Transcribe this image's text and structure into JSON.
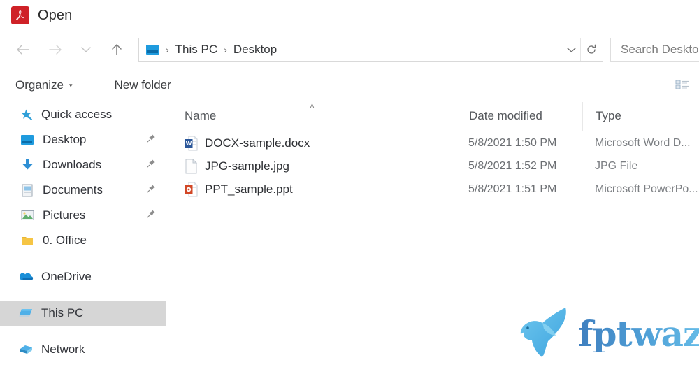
{
  "window": {
    "title": "Open",
    "app_icon": "adobe-acrobat-icon",
    "accent_red": "#cf2127",
    "accent_blue": "#1f9bde",
    "selection_gray": "#d6d6d6"
  },
  "navigation": {
    "back_icon": "arrow-left-icon",
    "forward_icon": "arrow-right-icon",
    "recent_icon": "chevron-down-icon",
    "up_icon": "arrow-up-icon",
    "address": {
      "location_icon": "desktop-monitor-icon",
      "separator": "›",
      "crumbs": [
        "This PC",
        "Desktop"
      ],
      "dropdown_icon": "chevron-down-icon",
      "refresh_icon": "refresh-icon"
    },
    "search": {
      "placeholder": "Search Desktop",
      "value": ""
    }
  },
  "toolbar": {
    "organize_label": "Organize",
    "organize_caret": "▾",
    "new_folder_label": "New folder",
    "view_icon": "list-view-icon"
  },
  "sidebar": {
    "groups": [
      {
        "header": {
          "label": "Quick access",
          "icon": "star-pin-icon"
        },
        "items": [
          {
            "label": "Desktop",
            "icon": "desktop-monitor-icon",
            "pinned": true
          },
          {
            "label": "Downloads",
            "icon": "download-arrow-icon",
            "pinned": true
          },
          {
            "label": "Documents",
            "icon": "documents-icon",
            "pinned": true
          },
          {
            "label": "Pictures",
            "icon": "pictures-icon",
            "pinned": true
          },
          {
            "label": "0. Office",
            "icon": "folder-icon",
            "pinned": false
          }
        ]
      },
      {
        "header": null,
        "items": [
          {
            "label": "OneDrive",
            "icon": "onedrive-cloud-icon",
            "pinned": false
          }
        ]
      },
      {
        "header": null,
        "items": [
          {
            "label": "This PC",
            "icon": "this-pc-icon",
            "pinned": false,
            "selected": true
          }
        ]
      },
      {
        "header": null,
        "items": [
          {
            "label": "Network",
            "icon": "network-icon",
            "pinned": false
          }
        ]
      }
    ],
    "pin_glyph": "📌"
  },
  "file_list": {
    "columns": [
      {
        "key": "name",
        "label": "Name",
        "sorted": "asc",
        "sort_glyph": "˄"
      },
      {
        "key": "date",
        "label": "Date modified",
        "sorted": null
      },
      {
        "key": "type",
        "label": "Type",
        "sorted": null
      }
    ],
    "rows": [
      {
        "name": "DOCX-sample.docx",
        "date": "5/8/2021 1:50 PM",
        "type": "Microsoft Word D...",
        "icon": "word-document-icon"
      },
      {
        "name": "JPG-sample.jpg",
        "date": "5/8/2021 1:52 PM",
        "type": "JPG File",
        "icon": "generic-file-icon"
      },
      {
        "name": "PPT_sample.ppt",
        "date": "5/8/2021 1:51 PM",
        "type": "Microsoft PowerPo...",
        "icon": "powerpoint-document-icon"
      }
    ]
  },
  "watermark": {
    "text": "fptwaze",
    "icon": "bird-logo-icon",
    "color_start": "#3f7fbf",
    "color_end": "#6cc6ee"
  }
}
